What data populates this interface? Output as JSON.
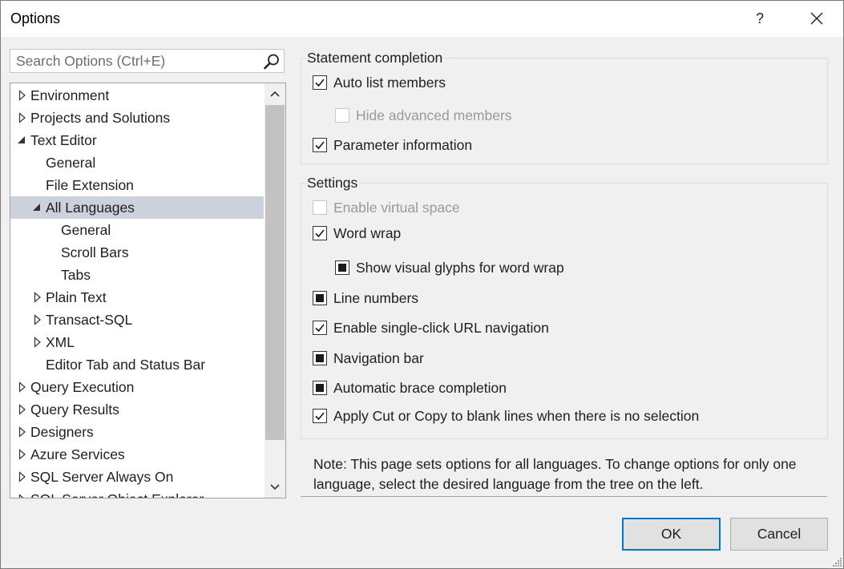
{
  "window": {
    "title": "Options",
    "help": "?"
  },
  "search": {
    "placeholder": "Search Options (Ctrl+E)"
  },
  "tree": {
    "items": [
      {
        "label": "Environment",
        "expander": "collapsed"
      },
      {
        "label": "Projects and Solutions",
        "expander": "collapsed"
      },
      {
        "label": "Text Editor",
        "expander": "expanded"
      },
      {
        "label": "General",
        "expander": "none"
      },
      {
        "label": "File Extension",
        "expander": "none"
      },
      {
        "label": "All Languages",
        "expander": "expanded",
        "selected": true
      },
      {
        "label": "General",
        "expander": "none"
      },
      {
        "label": "Scroll Bars",
        "expander": "none"
      },
      {
        "label": "Tabs",
        "expander": "none"
      },
      {
        "label": "Plain Text",
        "expander": "collapsed"
      },
      {
        "label": "Transact-SQL",
        "expander": "collapsed"
      },
      {
        "label": "XML",
        "expander": "collapsed"
      },
      {
        "label": "Editor Tab and Status Bar",
        "expander": "none"
      },
      {
        "label": "Query Execution",
        "expander": "collapsed"
      },
      {
        "label": "Query Results",
        "expander": "collapsed"
      },
      {
        "label": "Designers",
        "expander": "collapsed"
      },
      {
        "label": "Azure Services",
        "expander": "collapsed"
      },
      {
        "label": "SQL Server Always On",
        "expander": "collapsed"
      },
      {
        "label": "SQL Server Object Explorer",
        "expander": "collapsed"
      }
    ]
  },
  "statement_completion": {
    "title": "Statement completion",
    "options": [
      {
        "label": "Auto list members",
        "state": "checked",
        "enabled": true
      },
      {
        "label": "Hide advanced members",
        "state": "unchecked",
        "enabled": false
      },
      {
        "label": "Parameter information",
        "state": "checked",
        "enabled": true
      }
    ]
  },
  "settings": {
    "title": "Settings",
    "options": [
      {
        "label": "Enable virtual space",
        "state": "unchecked",
        "enabled": false
      },
      {
        "label": "Word wrap",
        "state": "checked",
        "enabled": true
      },
      {
        "label": "Show visual glyphs for word wrap",
        "state": "indeterminate",
        "enabled": true
      },
      {
        "label": "Line numbers",
        "state": "indeterminate",
        "enabled": true
      },
      {
        "label": "Enable single-click URL navigation",
        "state": "checked",
        "enabled": true
      },
      {
        "label": "Navigation bar",
        "state": "indeterminate",
        "enabled": true
      },
      {
        "label": "Automatic brace completion",
        "state": "indeterminate",
        "enabled": true
      },
      {
        "label": "Apply Cut or Copy to blank lines when there is no selection",
        "state": "checked",
        "enabled": true
      }
    ]
  },
  "note": "Note: This page sets options for all languages. To change options for only one language, select the desired language from the tree on the left.",
  "buttons": {
    "ok": "OK",
    "cancel": "Cancel"
  }
}
